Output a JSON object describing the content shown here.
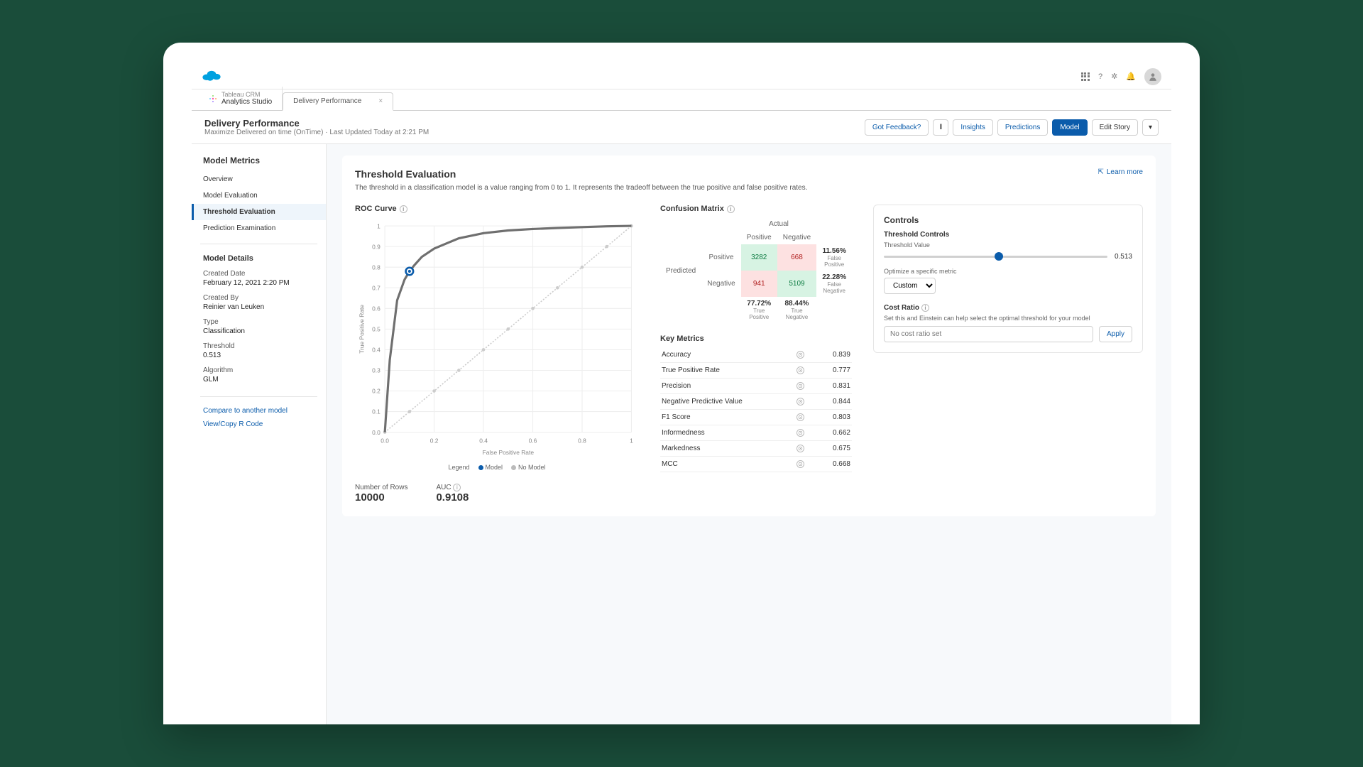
{
  "tabs": {
    "app_name": "Tableau CRM",
    "app_sub": "Analytics Studio",
    "page_tab": "Delivery Performance"
  },
  "header": {
    "title": "Delivery Performance",
    "subtitle": "Maximize Delivered on time (OnTime) · Last Updated Today at 2:21 PM",
    "feedback": "Got Feedback?",
    "insights": "Insights",
    "predictions": "Predictions",
    "model": "Model",
    "edit": "Edit Story"
  },
  "sidebar": {
    "title": "Model Metrics",
    "items": [
      "Overview",
      "Model Evaluation",
      "Threshold Evaluation",
      "Prediction Examination"
    ],
    "details_title": "Model Details",
    "d1_label": "Created Date",
    "d1_val": "February 12, 2021 2:20 PM",
    "d2_label": "Created By",
    "d2_val": "Reinier van Leuken",
    "d3_label": "Type",
    "d3_val": "Classification",
    "d4_label": "Threshold",
    "d4_val": "0.513",
    "d5_label": "Algorithm",
    "d5_val": "GLM",
    "link1": "Compare to another model",
    "link2": "View/Copy R Code"
  },
  "main": {
    "title": "Threshold Evaluation",
    "desc": "The threshold in a classification model is a value ranging from 0 to 1. It represents the tradeoff between the true positive and false positive rates.",
    "learn": "Learn more"
  },
  "roc": {
    "title": "ROC Curve",
    "xlabel": "False Positive Rate",
    "ylabel": "True Positive Rate",
    "legend_label": "Legend",
    "legend_model": "Model",
    "legend_nomodel": "No Model",
    "rows_label": "Number of Rows",
    "rows_val": "10000",
    "auc_label": "AUC",
    "auc_val": "0.9108"
  },
  "confusion": {
    "title": "Confusion Matrix",
    "actual": "Actual",
    "predicted": "Predicted",
    "positive": "Positive",
    "negative": "Negative",
    "tp": "3282",
    "fp": "668",
    "fn": "941",
    "tn": "5109",
    "fp_pct": "11.56%",
    "fp_lbl": "False Positive",
    "fn_pct": "22.28%",
    "fn_lbl": "False Negative",
    "col1_pct": "77.72%",
    "col1_lbl": "True Positive",
    "col2_pct": "88.44%",
    "col2_lbl": "True Negative"
  },
  "metrics": {
    "title": "Key Metrics",
    "rows": [
      {
        "name": "Accuracy",
        "val": "0.839"
      },
      {
        "name": "True Positive Rate",
        "val": "0.777"
      },
      {
        "name": "Precision",
        "val": "0.831"
      },
      {
        "name": "Negative Predictive Value",
        "val": "0.844"
      },
      {
        "name": "F1 Score",
        "val": "0.803"
      },
      {
        "name": "Informedness",
        "val": "0.662"
      },
      {
        "name": "Markedness",
        "val": "0.675"
      },
      {
        "name": "MCC",
        "val": "0.668"
      }
    ]
  },
  "controls": {
    "title": "Controls",
    "th_title": "Threshold Controls",
    "th_label": "Threshold Value",
    "th_val": "0.513",
    "optimize": "Optimize a specific metric",
    "select_val": "Custom",
    "cost_title": "Cost Ratio",
    "cost_desc": "Set this and Einstein can help select the optimal threshold for your model",
    "cost_placeholder": "No cost ratio set",
    "apply": "Apply"
  },
  "chart_data": {
    "type": "line",
    "title": "ROC Curve",
    "xlabel": "False Positive Rate",
    "ylabel": "True Positive Rate",
    "xlim": [
      0,
      1
    ],
    "ylim": [
      0,
      1
    ],
    "series": [
      {
        "name": "Model",
        "x": [
          0,
          0.02,
          0.05,
          0.08,
          0.1,
          0.12,
          0.15,
          0.2,
          0.3,
          0.4,
          0.5,
          0.6,
          0.7,
          0.8,
          0.9,
          1.0
        ],
        "y": [
          0,
          0.35,
          0.64,
          0.74,
          0.78,
          0.81,
          0.85,
          0.89,
          0.94,
          0.965,
          0.978,
          0.985,
          0.99,
          0.994,
          0.998,
          1.0
        ]
      },
      {
        "name": "No Model",
        "x": [
          0,
          0.1,
          0.2,
          0.3,
          0.4,
          0.5,
          0.6,
          0.7,
          0.8,
          0.9,
          1.0
        ],
        "y": [
          0,
          0.1,
          0.2,
          0.3,
          0.4,
          0.5,
          0.6,
          0.7,
          0.8,
          0.9,
          1.0
        ]
      }
    ],
    "threshold_point": {
      "x": 0.1,
      "y": 0.78
    },
    "auc": 0.9108,
    "n_rows": 10000
  }
}
